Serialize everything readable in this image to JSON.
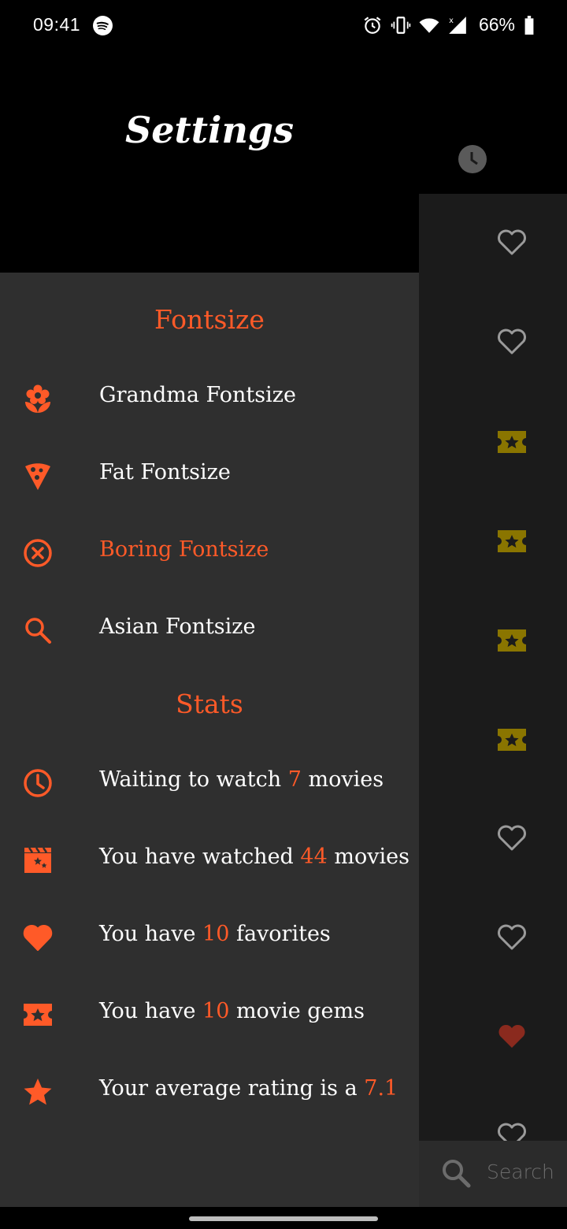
{
  "status_bar": {
    "time": "09:41",
    "battery": "66%",
    "icons": [
      "spotify-icon",
      "alarm-icon",
      "vibrate-icon",
      "wifi-icon",
      "signal-icon",
      "battery-icon"
    ]
  },
  "drawer": {
    "title": "Settings",
    "fontsize_section": {
      "heading": "Fontsize",
      "options": [
        {
          "label": "Grandma Fontsize",
          "icon": "flower-icon",
          "selected": false
        },
        {
          "label": "Fat Fontsize",
          "icon": "pizza-icon",
          "selected": false
        },
        {
          "label": "Boring Fontsize",
          "icon": "close-circle-icon",
          "selected": true
        },
        {
          "label": "Asian Fontsize",
          "icon": "search-icon",
          "selected": false
        }
      ]
    },
    "stats_section": {
      "heading": "Stats",
      "items": [
        {
          "prefix": "Waiting to watch ",
          "value": "7",
          "suffix": " movies",
          "icon": "clock-icon"
        },
        {
          "prefix": "You have watched ",
          "value": "44",
          "suffix": " movies",
          "icon": "clapperboard-icon"
        },
        {
          "prefix": "You have ",
          "value": "10",
          "suffix": " favorites",
          "icon": "heart-icon"
        },
        {
          "prefix": "You have ",
          "value": "10",
          "suffix": " movie gems",
          "icon": "ticket-star-icon"
        },
        {
          "prefix": "Your average rating is a ",
          "value": "7.1",
          "suffix": "",
          "icon": "star-icon"
        }
      ]
    }
  },
  "background_list": {
    "search_placeholder": "Search"
  },
  "colors": {
    "accent": "#ff5a28",
    "drawer_bg": "#2f2f2f",
    "list_bg": "#1b1b1b",
    "gem_icon": "#8a7500",
    "favorite_active": "#8a2a1e"
  }
}
